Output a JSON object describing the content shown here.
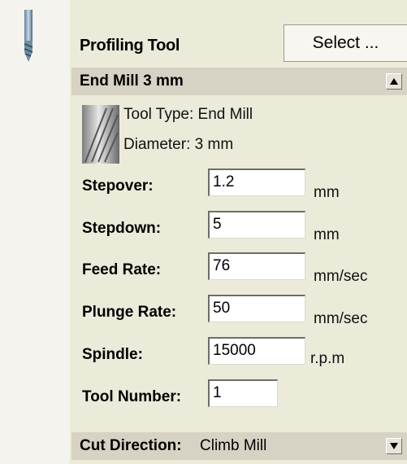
{
  "panel": {
    "title": "Profiling Tool",
    "select_label": "Select ..."
  },
  "tool": {
    "name": "End Mill 3 mm",
    "type_label": "Tool Type:",
    "type_value": "End Mill",
    "diameter_label": "Diameter:",
    "diameter_value": "3 mm"
  },
  "fields": {
    "stepover": {
      "label": "Stepover:",
      "value": "1.2",
      "unit": "mm"
    },
    "stepdown": {
      "label": "Stepdown:",
      "value": "5",
      "unit": "mm"
    },
    "feed_rate": {
      "label": "Feed Rate:",
      "value": "76",
      "unit": "mm/sec"
    },
    "plunge_rate": {
      "label": "Plunge Rate:",
      "value": "50",
      "unit": "mm/sec"
    },
    "spindle": {
      "label": "Spindle:",
      "value": "15000",
      "unit": "r.p.m"
    },
    "tool_number": {
      "label": "Tool Number:",
      "value": "1"
    }
  },
  "cut_direction": {
    "label": "Cut Direction:",
    "value": "Climb Mill"
  },
  "icons": {
    "section": "end-mill-icon",
    "collapse": "triangle-up-icon",
    "expand": "triangle-down-icon",
    "thumb": "tool-thumbnail-icon"
  }
}
